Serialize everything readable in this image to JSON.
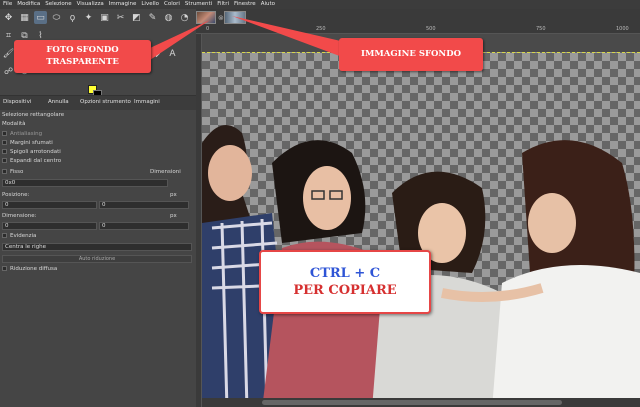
{
  "menu": [
    "File",
    "Modifica",
    "Selezione",
    "Visualizza",
    "Immagine",
    "Livello",
    "Colori",
    "Strumenti",
    "Filtri",
    "Finestre",
    "Aiuto"
  ],
  "ruler": {
    "labels": [
      "0",
      "250",
      "500",
      "750",
      "1000"
    ]
  },
  "dock": {
    "tabs": [
      "Dispositivi",
      "Annulla",
      "Opzioni strumento",
      "Immagini"
    ],
    "title": "Selezione rettangolare",
    "mode_label": "Modalità",
    "antialiasing": "Antialiasing",
    "feather": "Margini sfumati",
    "rounded": "Spigoli arrotondati",
    "expand": "Espandi dal centro",
    "fixed_label": "Fisso",
    "fixed_value": "Dimensioni",
    "ratio_value": "0x0",
    "position_label": "Posizione:",
    "position_unit": "px",
    "position_x": "0",
    "position_y": "0",
    "size_label": "Dimensione:",
    "size_unit": "px",
    "size_w": "0",
    "size_h": "0",
    "highlight": "Evidenzia",
    "guides_value": "Centra le righe",
    "autoshrink": "Auto riduzione",
    "shrink_merged": "Riduzione diffusa"
  },
  "callouts": {
    "left": "FOTO SFONDO\nTRASPARENTE",
    "right": "IMMAGINE SFONDO",
    "ctrl_line1": "CTRL + C",
    "ctrl_line2": "PER COPIARE"
  },
  "colors": {
    "callout": "#f24a4a",
    "fg": "#ffff33",
    "bg": "#000000",
    "accent_blue": "#2e54d6"
  }
}
